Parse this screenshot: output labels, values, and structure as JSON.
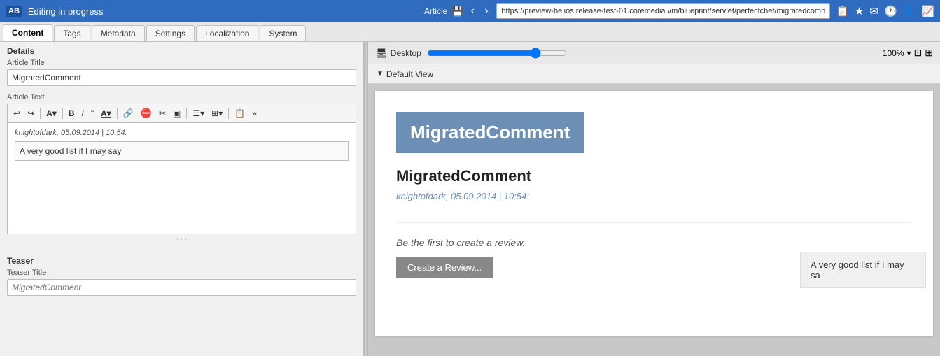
{
  "topbar": {
    "logo": "AB",
    "status": "Editing in progress",
    "article_label": "Article",
    "url": "https://preview-helios.release-test-01.coremedia.vm/blueprint/servlet/perfectchef/migratedcomn",
    "icons": [
      "📋",
      "★",
      "✉",
      "🕐",
      "👤",
      "📈"
    ]
  },
  "tabs": [
    {
      "label": "Content",
      "active": true
    },
    {
      "label": "Tags",
      "active": false
    },
    {
      "label": "Metadata",
      "active": false
    },
    {
      "label": "Settings",
      "active": false
    },
    {
      "label": "Localization",
      "active": false
    },
    {
      "label": "System",
      "active": false
    }
  ],
  "left_panel": {
    "section_details": "Details",
    "article_title_label": "Article Title",
    "article_title_value": "MigratedComment",
    "article_text_label": "Article Text",
    "toolbar_buttons": [
      "↩",
      "↪",
      "A",
      "B",
      "I",
      "\"",
      "A",
      "🔗",
      "🚫",
      "✂",
      "🖼",
      "≡",
      "⊞",
      "📋",
      "»"
    ],
    "comment_author": "knightofdark, 05.09.2014 | 10:54:",
    "comment_text": "A very good list if I may say",
    "section_teaser": "Teaser",
    "teaser_title_label": "Teaser Title",
    "teaser_title_placeholder": "MigratedComment"
  },
  "right_panel": {
    "device_label": "Desktop",
    "view_label": "Default View",
    "zoom": "100%",
    "preview": {
      "title_banner": "MigratedComment",
      "article_title": "MigratedComment",
      "author": "knightofdark, 05.09.2014 | 10:54:",
      "comment_bubble": "A very good list if I may sa",
      "review_prompt": "Be the first to create a review.",
      "review_button": "Create a Review..."
    }
  }
}
